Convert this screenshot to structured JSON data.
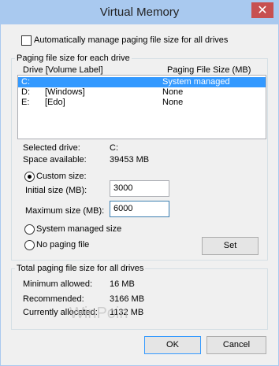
{
  "window": {
    "title": "Virtual Memory",
    "close_glyph": "✕"
  },
  "auto_manage": {
    "label": "Automatically manage paging file size for all drives",
    "checked": false
  },
  "drive_group": {
    "title": "Paging file size for each drive",
    "col_drive": "Drive  [Volume Label]",
    "col_size": "Paging File Size (MB)",
    "rows": [
      {
        "drive": "C:",
        "label": "",
        "size": "System managed",
        "selected": true
      },
      {
        "drive": "D:",
        "label": "[Windows]",
        "size": "None",
        "selected": false
      },
      {
        "drive": "E:",
        "label": "[Edo]",
        "size": "None",
        "selected": false
      }
    ],
    "selected_drive_label": "Selected drive:",
    "selected_drive_value": "C:",
    "space_available_label": "Space available:",
    "space_available_value": "39453 MB"
  },
  "options": {
    "custom_size": {
      "label": "Custom size:",
      "checked": true
    },
    "initial_label": "Initial size (MB):",
    "initial_value": "3000",
    "maximum_label": "Maximum size (MB):",
    "maximum_value": "6000",
    "system_managed": {
      "label": "System managed size",
      "checked": false
    },
    "no_paging": {
      "label": "No paging file",
      "checked": false
    },
    "set_label": "Set"
  },
  "totals_group": {
    "title": "Total paging file size for all drives",
    "min_label": "Minimum allowed:",
    "min_value": "16 MB",
    "rec_label": "Recommended:",
    "rec_value": "3166 MB",
    "cur_label": "Currently allocated:",
    "cur_value": "1132 MB"
  },
  "buttons": {
    "ok": "OK",
    "cancel": "Cancel"
  },
  "watermark": "WinPoin",
  "colors": {
    "titlebar": "#a9c9ef",
    "close": "#c75050",
    "selection": "#3399ff"
  }
}
